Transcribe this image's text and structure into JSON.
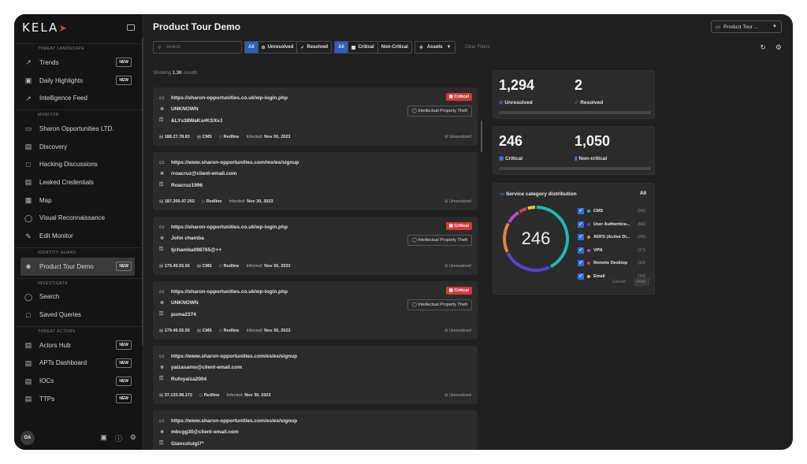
{
  "sidebar": {
    "logo": "KELA",
    "sections": {
      "threat_landscape": "THREAT LANDSCAPE",
      "monitor": "MONITOR",
      "identity_guard": "IDENTITY GUARD",
      "investigate": "INVESTIGATE",
      "threat_actors": "THREAT ACTORS"
    },
    "items": {
      "trends": "Trends",
      "daily_highlights": "Daily Highlights",
      "intelligence_feed": "Intelligence Feed",
      "sharon": "Sharon Opportunities LTD.",
      "discovery": "Discovery",
      "hacking": "Hacking Discussions",
      "leaked": "Leaked Credentials",
      "map": "Map",
      "visual_recon": "Visual Reconnaissance",
      "edit_monitor": "Edit Monitor",
      "product_tour": "Product Tour Demo",
      "search": "Search",
      "saved_queries": "Saved Queries",
      "actors_hub": "Actors Hub",
      "apts": "APTs Dashboard",
      "iocs": "IOCs",
      "ttps": "TTPs"
    },
    "badge_new": "NEW",
    "avatar": "OA"
  },
  "header": {
    "title": "Product Tour Demo",
    "demo_select": "Product Tour ..."
  },
  "filters": {
    "search_placeholder": "Search",
    "all": "All",
    "unresolved": "Unresolved",
    "resolved": "Resolved",
    "all2": "All",
    "critical": "Critical",
    "non_critical": "Non-Critical",
    "assets": "Assets",
    "clear": "Clear Filters"
  },
  "results": {
    "showing_prefix": "Showing",
    "count": "1.3K",
    "suffix": "results"
  },
  "labels": {
    "critical": "Critical",
    "ipt": "Intellectual Property Theft",
    "unresolved": "Unresolved",
    "infected": "Infected:"
  },
  "cards": [
    {
      "url": "https://sharon-opportunities.co.uk/wp-login.php",
      "user": "UNKNOWN",
      "pass": "&LYs38WaKs#KSXvJ",
      "ip": "188.27.78.83",
      "cms": "CMS",
      "malware": "Redline",
      "date": "Nov 30, 2023"
    },
    {
      "url": "https://www.sharon-opportunities.com/mx/es/signup",
      "user": "rroacruz@client-email.com",
      "pass": "Roacruz1996",
      "ip": "187.200.47.202",
      "malware": "Redline",
      "date": "Nov 30, 2023"
    },
    {
      "url": "https://sharon-opportunities.co.uk/wp-login.php",
      "user": "John chamba",
      "pass": "tjchamba098765@++",
      "ip": "179.49.55.55",
      "cms": "CMS",
      "malware": "Redline",
      "date": "Nov 30, 2023"
    },
    {
      "url": "https://sharon-opportunities.co.uk/wp-login.php",
      "user": "UNKNOWN",
      "pass": "puma2374",
      "ip": "179.49.55.55",
      "cms": "CMS",
      "malware": "Redline",
      "date": "Nov 30, 2023"
    },
    {
      "url": "https://www.sharon-opportunities.com/es/es/signup",
      "user": "yaizasamo@client-email.com",
      "pass": "Rufoyaiza2004",
      "ip": "37.133.98.172",
      "malware": "Redline",
      "date": "Nov 30, 2023"
    },
    {
      "url": "https://www.sharon-opportunities.com/es/es/signup",
      "user": "mbcgg30@client-email.com",
      "pass": "Giancoluigi7*"
    }
  ],
  "stats": {
    "unresolved_count": "1,294",
    "unresolved_label": "Unresolved",
    "resolved_count": "2",
    "resolved_label": "Resolved",
    "critical_count": "246",
    "critical_label": "Critical",
    "noncritical_count": "1,050",
    "noncritical_label": "Non-critical"
  },
  "distribution": {
    "title": "Service category distribution",
    "all": "All",
    "center": "246",
    "items": [
      {
        "name": "CMS",
        "count": "(95)",
        "color": "#1fb7b0"
      },
      {
        "name": "User Authentica...",
        "count": "(56)",
        "color": "#5b3fd6"
      },
      {
        "name": "ADFS (Active Di...",
        "count": "(35)",
        "color": "#e8813a"
      },
      {
        "name": "VPN",
        "count": "(17)",
        "color": "#b04ad8"
      },
      {
        "name": "Remote Desktop",
        "count": "(10)",
        "color": "#d43f5e"
      },
      {
        "name": "Email",
        "count": "(10)",
        "color": "#e3c23a"
      }
    ],
    "cancel": "Cancel",
    "filter": "Filter"
  }
}
